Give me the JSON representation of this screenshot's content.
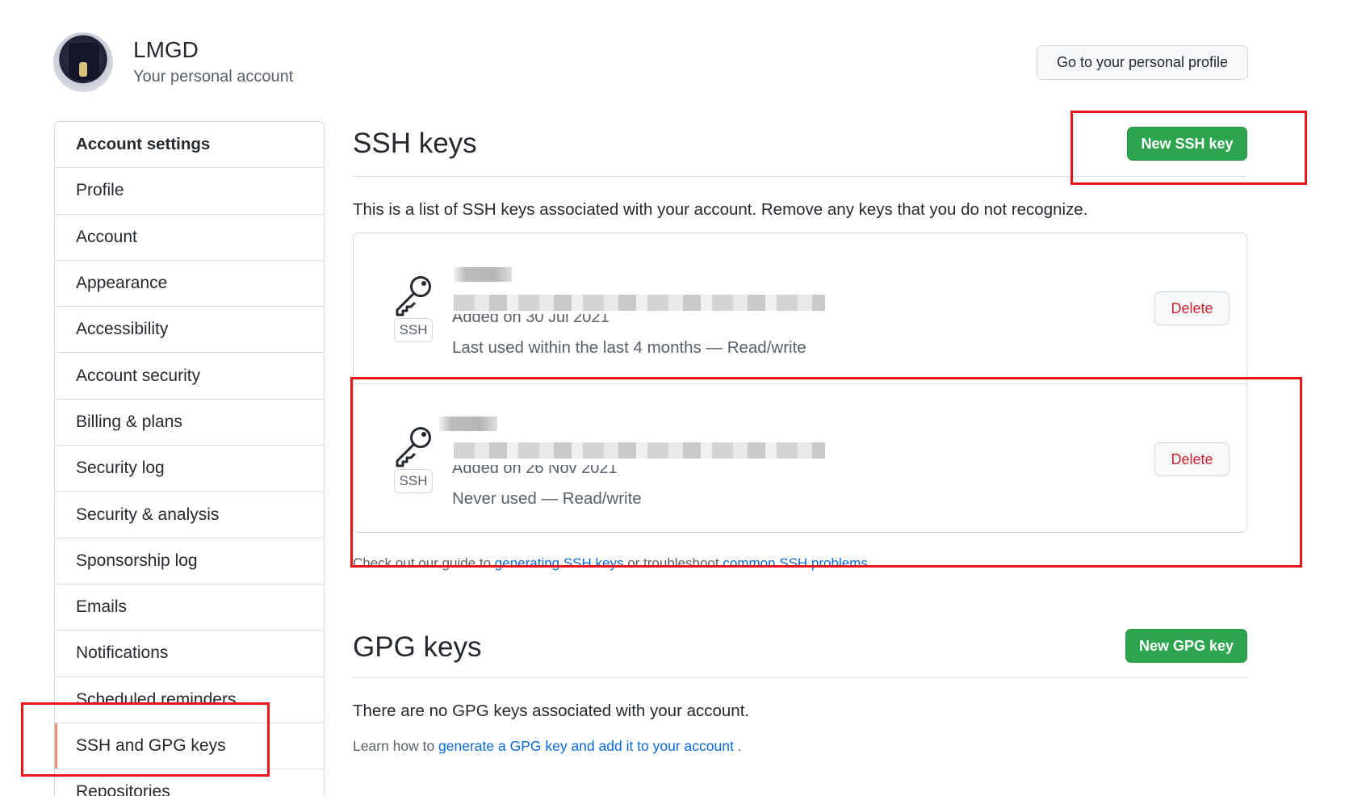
{
  "header": {
    "account_name": "LMGD",
    "account_subtitle": "Your personal account",
    "profile_button": "Go to your personal profile"
  },
  "sidebar": {
    "items": [
      {
        "label": "Account settings"
      },
      {
        "label": "Profile"
      },
      {
        "label": "Account"
      },
      {
        "label": "Appearance"
      },
      {
        "label": "Accessibility"
      },
      {
        "label": "Account security"
      },
      {
        "label": "Billing & plans"
      },
      {
        "label": "Security log"
      },
      {
        "label": "Security & analysis"
      },
      {
        "label": "Sponsorship log"
      },
      {
        "label": "Emails"
      },
      {
        "label": "Notifications"
      },
      {
        "label": "Scheduled reminders"
      },
      {
        "label": "SSH and GPG keys"
      },
      {
        "label": "Repositories"
      }
    ],
    "selected": "SSH and GPG keys"
  },
  "ssh": {
    "title": "SSH keys",
    "new_button": "New SSH key",
    "description": "This is a list of SSH keys associated with your account. Remove any keys that you do not recognize.",
    "keys": [
      {
        "badge": "SSH",
        "added": "Added on 30 Jul 2021",
        "usage": "Last used within the last 4 months — Read/write",
        "delete_label": "Delete"
      },
      {
        "badge": "SSH",
        "added": "Added on 26 Nov 2021",
        "usage": "Never used — Read/write",
        "delete_label": "Delete"
      }
    ],
    "guide": {
      "prefix": "Check out our guide to ",
      "link1": "generating SSH keys",
      "middle": " or troubleshoot ",
      "link2": "common SSH problems",
      "suffix": "."
    }
  },
  "gpg": {
    "title": "GPG keys",
    "new_button": "New GPG key",
    "empty_text": "There are no GPG keys associated with your account.",
    "learn_prefix": "Learn how to ",
    "learn_link": "generate a GPG key and add it to your account",
    "learn_suffix": " ."
  },
  "colors": {
    "primary_green": "#2da44e",
    "danger_red": "#cf222e",
    "link_blue": "#0969da",
    "annotation_red": "#e8161b"
  }
}
